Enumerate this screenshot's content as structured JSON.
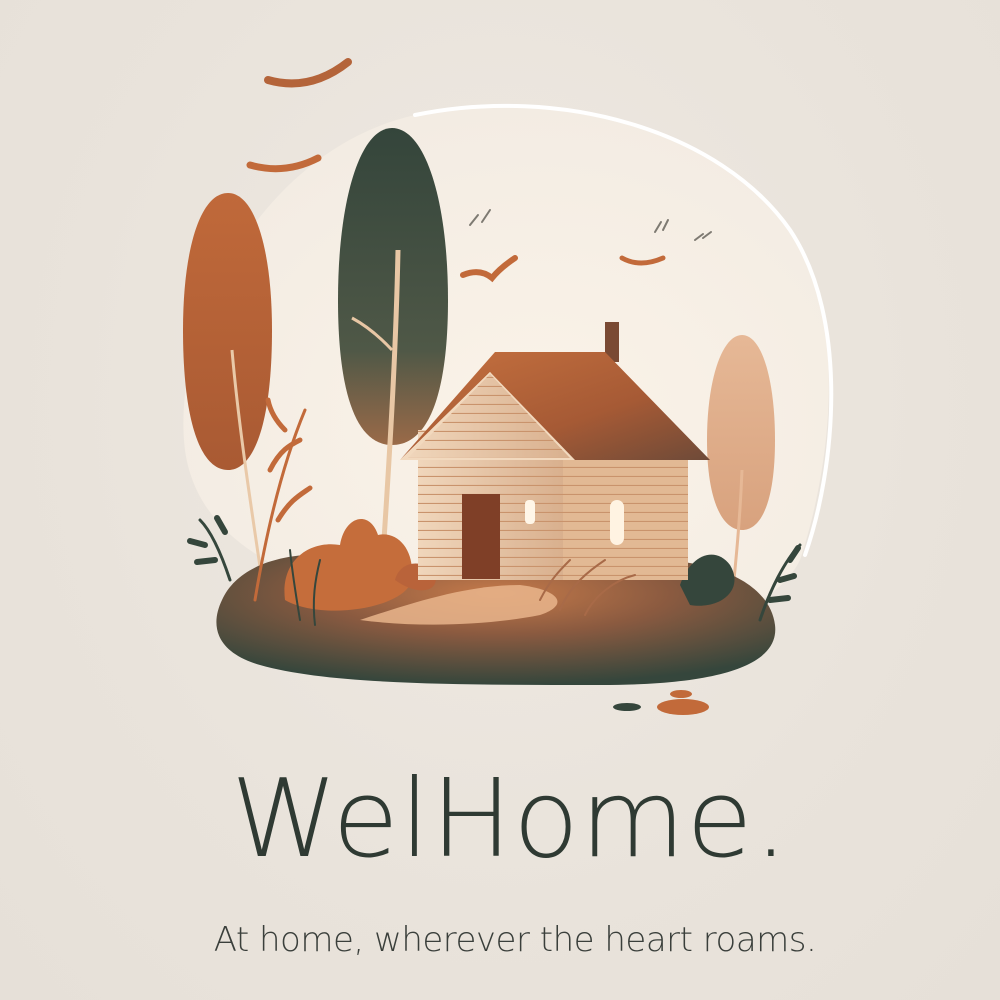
{
  "brand": {
    "name": "WelHome.",
    "tagline": "At home, wherever the heart roams."
  },
  "illustration": {
    "subject": "cottage-among-trees",
    "colors": {
      "background": "#ece6de",
      "backdrop": "#f6f1ea",
      "orange": "#c26a3a",
      "dark_green": "#35463c",
      "house_light": "#e9c9a8",
      "roof": "#b9633a",
      "text": "#2f3a33"
    }
  }
}
